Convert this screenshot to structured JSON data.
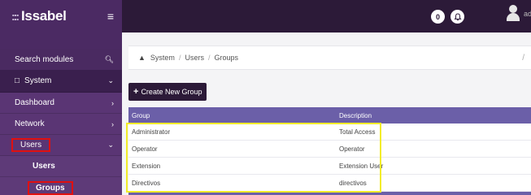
{
  "app": {
    "logo_text": "Issabel",
    "logo_dots": ":::"
  },
  "topbar": {
    "badge_one": "0",
    "user_text": "ad"
  },
  "sidebar": {
    "search_label": "Search modules",
    "system_label": "System",
    "items": [
      {
        "label": "Dashboard"
      },
      {
        "label": "Network"
      },
      {
        "label": "Users"
      }
    ],
    "subitems": [
      {
        "label": "Users"
      },
      {
        "label": "Groups"
      }
    ]
  },
  "breadcrumb": {
    "items": [
      "System",
      "Users",
      "Groups"
    ],
    "right": "/"
  },
  "actions": {
    "create_label": "Create New Group"
  },
  "table": {
    "columns": [
      "Group",
      "Description"
    ],
    "rows": [
      [
        "Administrator",
        "Total Access"
      ],
      [
        "Operator",
        "Operator"
      ],
      [
        "Extension",
        "Extension User"
      ],
      [
        "Directivos",
        "directivos"
      ]
    ]
  },
  "colors": {
    "sidebar": "#4b2a63",
    "topbar": "#2c1a38",
    "table_header": "#6b5fa8",
    "highlight_red": "#e01010",
    "highlight_yellow": "#f2ec2a"
  }
}
